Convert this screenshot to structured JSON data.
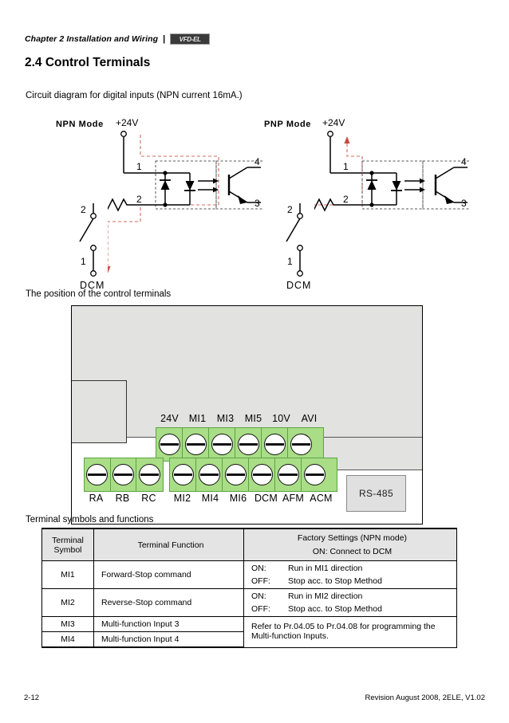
{
  "header": {
    "chapter": "Chapter 2 Installation and Wiring",
    "separator": "|",
    "logo_text": "VFD-EL"
  },
  "section": {
    "title": "2.4 Control Terminals"
  },
  "intro": {
    "circuit_caption": "Circuit diagram for digital inputs (NPN current 16mA.)",
    "position_caption": "The position of the control terminals",
    "table_caption": "Terminal symbols and functions"
  },
  "circuits": [
    {
      "mode": "NPN Mode",
      "supply_label": "+24V",
      "ground_label": "DCM",
      "opto_pin_1": "1",
      "opto_pin_2": "2",
      "opto_pin_3": "3",
      "opto_pin_4": "4",
      "switch_top": "2",
      "switch_bottom": "1",
      "current_direction": "down",
      "accent_color": "#c0392b"
    },
    {
      "mode": "PNP Mode",
      "supply_label": "+24V",
      "ground_label": "DCM",
      "opto_pin_1": "1",
      "opto_pin_2": "2",
      "opto_pin_3": "3",
      "opto_pin_4": "4",
      "switch_top": "2",
      "switch_bottom": "1",
      "current_direction": "up",
      "accent_color": "#c0392b"
    }
  ],
  "terminal_block": {
    "rs485_label": "RS-485",
    "top_row": [
      "24V",
      "MI1",
      "MI3",
      "MI5",
      "10V",
      "AVI"
    ],
    "relay_row": [
      "RA",
      "RB",
      "RC"
    ],
    "bottom_row": [
      "MI2",
      "MI4",
      "MI6",
      "DCM",
      "AFM",
      "ACM"
    ],
    "terminal_color": "#a9dd86",
    "body_color": "#e2e2e0"
  },
  "table": {
    "headers": {
      "symbol": "Terminal\nSymbol",
      "symbol_line1": "Terminal",
      "symbol_line2": "Symbol",
      "function": "Terminal Function",
      "settings_line1": "Factory Settings (NPN mode)",
      "settings_line2": "ON: Connect to DCM"
    },
    "rows": [
      {
        "symbol": "MI1",
        "function": "Forward-Stop command",
        "on_key": "ON:",
        "on_value": "Run in MI1 direction",
        "off_key": "OFF:",
        "off_value": "Stop acc. to Stop Method"
      },
      {
        "symbol": "MI2",
        "function": "Reverse-Stop command",
        "on_key": "ON:",
        "on_value": "Run in MI2 direction",
        "off_key": "OFF:",
        "off_value": "Stop acc. to Stop Method"
      },
      {
        "symbol": "MI3",
        "function": "Multi-function Input 3",
        "note": "Refer to Pr.04.05 to Pr.04.08 for programming the Multi-function Inputs."
      },
      {
        "symbol": "MI4",
        "function": "Multi-function Input 4"
      }
    ]
  },
  "footer": {
    "page_number": "2-12",
    "revision": "Revision August 2008, 2ELE, V1.02"
  }
}
